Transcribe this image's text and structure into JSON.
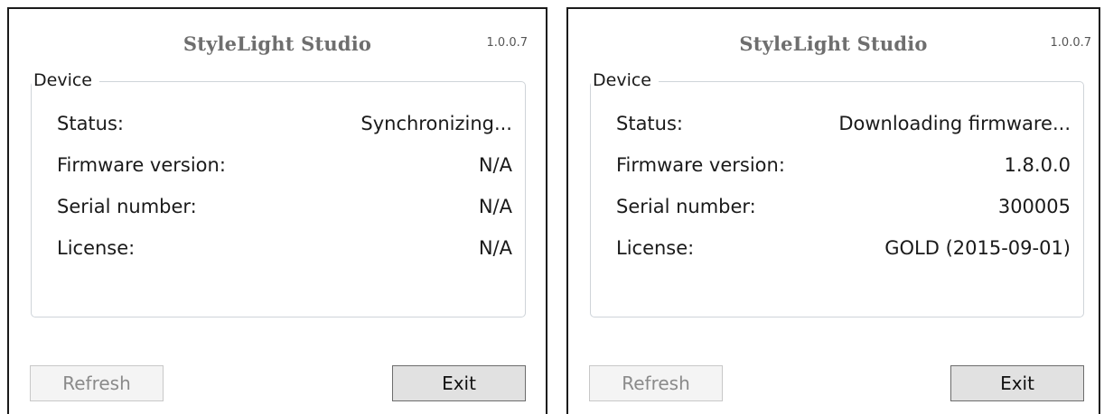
{
  "windows": [
    {
      "app_title": "StyleLight Studio",
      "version": "1.0.0.7",
      "group_label": "Device",
      "rows": [
        {
          "label": "Status:",
          "value": "Synchronizing..."
        },
        {
          "label": "Firmware version:",
          "value": "N/A"
        },
        {
          "label": "Serial number:",
          "value": "N/A"
        },
        {
          "label": "License:",
          "value": "N/A"
        }
      ],
      "refresh_label": "Refresh",
      "exit_label": "Exit"
    },
    {
      "app_title": "StyleLight Studio",
      "version": "1.0.0.7",
      "group_label": "Device",
      "rows": [
        {
          "label": "Status:",
          "value": "Downloading firmware..."
        },
        {
          "label": "Firmware version:",
          "value": "1.8.0.0"
        },
        {
          "label": "Serial number:",
          "value": "300005"
        },
        {
          "label": "License:",
          "value": "GOLD (2015-09-01)"
        }
      ],
      "refresh_label": "Refresh",
      "exit_label": "Exit"
    }
  ],
  "colors": {
    "title": "#6e6e6e",
    "groupbox_border": "#cfd4d9",
    "refresh_disabled_text": "#8a8a8a",
    "exit_button_bg": "#e1e1e1"
  }
}
